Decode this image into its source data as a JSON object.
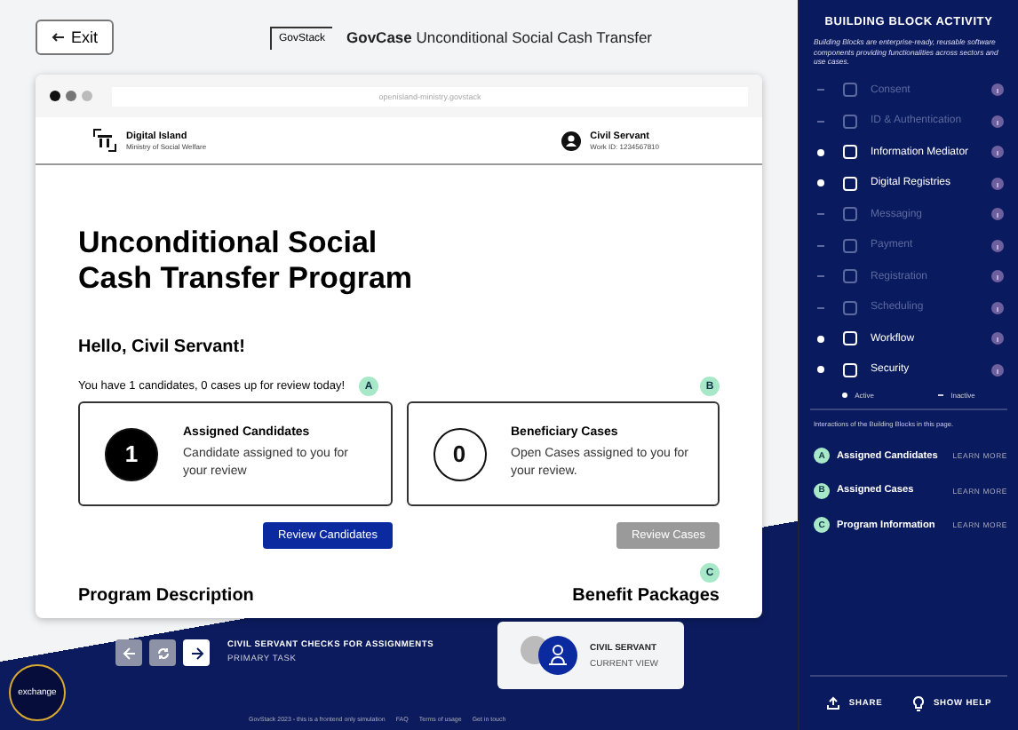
{
  "header": {
    "exit_button": "Exit",
    "logo": "GovStack",
    "title_bold": "GovCase",
    "title": "Unconditional Social Cash Transfer"
  },
  "browser": {
    "url": "openisland-ministry.govstack",
    "site_header": {
      "org_name": "Digital Island",
      "org_sub": "Ministry of Social Welfare",
      "user_name": "Civil Servant",
      "user_id": "Work ID: 1234567810"
    },
    "page_title": "Unconditional Social Cash Transfer Program",
    "greeting": "Hello, Civil Servant!",
    "summary": "You have 1 candidates, 0 cases up for review today!",
    "markers": [
      "A",
      "B",
      "C"
    ],
    "cards": [
      {
        "count": "1",
        "title": "Assigned Candidates",
        "text": "Candidate assigned to you for your review",
        "filled": true,
        "button": "Review Candidates",
        "disabled": false
      },
      {
        "count": "0",
        "title": "Beneficiary Cases",
        "text": "Open Cases assigned to you for your review.",
        "filled": false,
        "button": "Review Cases",
        "disabled": true
      }
    ],
    "sections": [
      "Program Description",
      "Benefit Packages"
    ]
  },
  "task": {
    "title": "CIVIL SERVANT CHECKS FOR ASSIGNMENTS",
    "subtitle": "PRIMARY TASK"
  },
  "view": {
    "title": "CIVIL SERVANT",
    "subtitle": "CURRENT VIEW"
  },
  "badge": "exchange",
  "footer": [
    "GovStack 2023 - this is a frontend only simulation",
    "FAQ",
    "Terms of usage",
    "Get in touch"
  ],
  "sidebar": {
    "title": "BUILDING BLOCK ACTIVITY",
    "intro": "Building Blocks are enterprise-ready, reusable software components providing functionalities across sectors and use cases.",
    "blocks": [
      {
        "name": "Consent",
        "active": false
      },
      {
        "name": "ID & Authentication",
        "active": false
      },
      {
        "name": "Information Mediator",
        "active": true
      },
      {
        "name": "Digital Registries",
        "active": true
      },
      {
        "name": "Messaging",
        "active": false
      },
      {
        "name": "Payment",
        "active": false
      },
      {
        "name": "Registration",
        "active": false
      },
      {
        "name": "Scheduling",
        "active": false
      },
      {
        "name": "Workflow",
        "active": true
      },
      {
        "name": "Security",
        "active": true
      }
    ],
    "legend": [
      "Active",
      "Inactive"
    ],
    "interactions_intro": "Interactions of the Building Blocks in this page.",
    "interactions": [
      {
        "letter": "A",
        "name": "Assigned Candidates",
        "link": "LEARN MORE"
      },
      {
        "letter": "B",
        "name": "Assigned Cases",
        "link": "LEARN MORE"
      },
      {
        "letter": "C",
        "name": "Program Information",
        "link": "LEARN MORE"
      }
    ],
    "share": "SHARE",
    "help": "SHOW HELP"
  }
}
